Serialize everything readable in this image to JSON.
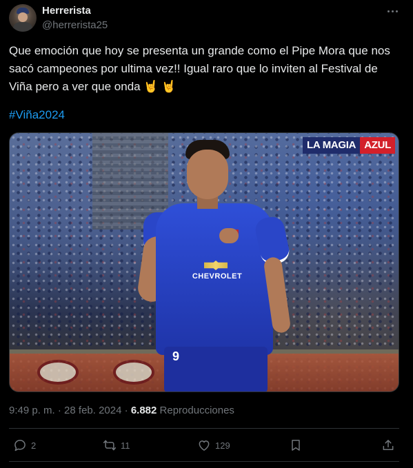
{
  "author": {
    "name": "Herrerista",
    "handle": "@herrerista25"
  },
  "tweet": {
    "text": "Que emoción que hoy se presenta un grande como el Pipe Mora que nos sacó campeones por ultima vez!! Igual raro que lo inviten al Festival de Viña pero a ver que onda 🤘 🤘",
    "hashtag": "#Viña2024"
  },
  "media": {
    "logo_part1": "LA MAGIA",
    "logo_part2": "AZUL",
    "sponsor": "CHEVROLET",
    "shorts_number": "9"
  },
  "meta": {
    "time": "9:49 p. m.",
    "separator": "·",
    "date": "28 feb. 2024",
    "views_count": "6.882",
    "views_label": "Reproducciones"
  },
  "actions": {
    "replies": "2",
    "retweets": "11",
    "likes": "129"
  },
  "icons": [
    "more-icon",
    "reply-icon",
    "retweet-icon",
    "like-icon",
    "bookmark-icon",
    "share-icon"
  ],
  "colors": {
    "background": "#000000",
    "text": "#e7e9ea",
    "muted": "#71767b",
    "link": "#1d9bf0",
    "border": "#2f3336"
  }
}
